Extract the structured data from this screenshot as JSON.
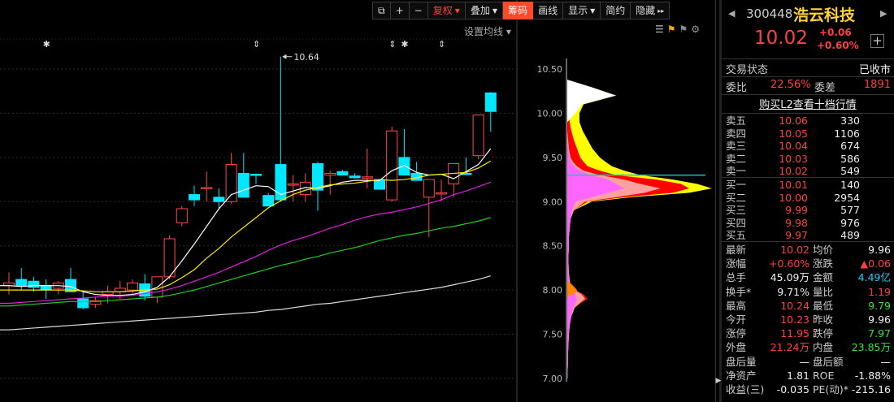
{
  "toolbar": {
    "buttons": [
      {
        "label": "⧉",
        "name": "window-mode-icon-button"
      },
      {
        "label": "+",
        "name": "zoom-in-button"
      },
      {
        "label": "−",
        "name": "zoom-out-button"
      },
      {
        "label": "复权",
        "caret": "▼",
        "name": "adjust-dropdown",
        "style": "red"
      },
      {
        "label": "叠加",
        "caret": "▼",
        "name": "overlay-dropdown"
      },
      {
        "label": "筹码",
        "name": "chips-button",
        "style": "active"
      },
      {
        "label": "画线",
        "name": "draw-line-button"
      },
      {
        "label": "显示",
        "caret": "▼",
        "name": "display-dropdown"
      },
      {
        "label": "简约",
        "name": "simple-button"
      },
      {
        "label": "隐藏",
        "caret": "▸▸",
        "name": "hide-button"
      }
    ]
  },
  "chart": {
    "setting_label": "设置均线 ▾",
    "high_marker": "10.64",
    "y_ticks": [
      "10.50",
      "10.00",
      "9.50",
      "9.00",
      "8.50",
      "8.00",
      "7.50",
      "7.00"
    ],
    "event_markers": [
      "✱",
      "⇕",
      "⇕",
      "✱",
      "⇕"
    ]
  },
  "chart_data": {
    "type": "candlestick",
    "title": "",
    "y_range": [
      6.98,
      10.64
    ],
    "ohlc": [
      [
        8.05,
        8.2,
        7.95,
        8.08
      ],
      [
        8.12,
        8.25,
        8.0,
        8.05
      ],
      [
        8.1,
        8.15,
        7.98,
        8.03
      ],
      [
        8.05,
        8.12,
        7.9,
        8.0
      ],
      [
        8.02,
        8.1,
        7.95,
        8.08
      ],
      [
        8.12,
        8.25,
        7.98,
        7.98
      ],
      [
        7.9,
        7.98,
        7.78,
        7.8
      ],
      [
        7.84,
        7.92,
        7.8,
        7.88
      ],
      [
        7.95,
        8.05,
        7.85,
        7.98
      ],
      [
        7.98,
        8.1,
        7.9,
        8.02
      ],
      [
        8.0,
        8.12,
        7.95,
        8.08
      ],
      [
        8.07,
        8.18,
        7.88,
        7.93
      ],
      [
        7.92,
        8.15,
        7.85,
        8.15
      ],
      [
        8.15,
        8.62,
        8.12,
        8.58
      ],
      [
        8.76,
        8.95,
        8.72,
        8.92
      ],
      [
        9.08,
        9.18,
        8.95,
        9.02
      ],
      [
        9.15,
        9.34,
        9.0,
        9.16
      ],
      [
        9.05,
        9.15,
        8.92,
        9.0
      ],
      [
        9.0,
        9.55,
        8.98,
        9.42
      ],
      [
        9.32,
        9.55,
        9.05,
        9.05
      ],
      [
        9.31,
        9.32,
        9.2,
        9.3
      ],
      [
        9.07,
        9.1,
        9.03,
        8.95
      ],
      [
        9.42,
        10.64,
        9.0,
        9.02
      ],
      [
        9.2,
        9.3,
        9.0,
        9.2
      ],
      [
        9.08,
        9.32,
        9.0,
        9.22
      ],
      [
        9.43,
        9.45,
        8.9,
        9.13
      ],
      [
        9.3,
        9.35,
        9.08,
        9.32
      ],
      [
        9.34,
        9.36,
        9.3,
        9.3
      ],
      [
        9.29,
        9.32,
        9.26,
        9.27
      ],
      [
        9.28,
        9.6,
        9.15,
        9.28
      ],
      [
        9.25,
        9.18,
        9.18,
        9.14
      ],
      [
        9.02,
        9.85,
        9.0,
        9.8
      ],
      [
        9.5,
        9.82,
        9.5,
        9.3
      ],
      [
        9.32,
        9.45,
        9.3,
        9.24
      ],
      [
        9.05,
        9.25,
        8.6,
        9.25
      ],
      [
        9.1,
        9.25,
        9.0,
        9.1
      ],
      [
        9.2,
        9.43,
        9.05,
        9.43
      ],
      [
        9.32,
        9.5,
        9.3,
        9.31
      ],
      [
        9.52,
        9.98,
        9.48,
        9.98
      ],
      [
        10.23,
        10.24,
        9.79,
        10.02
      ]
    ],
    "ma_series": [
      {
        "name": "MA5",
        "color": "#ffffff",
        "values": [
          8.05,
          8.04,
          8.05,
          8.05,
          8.05,
          8.04,
          7.98,
          7.95,
          7.94,
          7.94,
          7.95,
          7.98,
          8.03,
          8.15,
          8.33,
          8.52,
          8.72,
          8.92,
          9.08,
          9.13,
          9.18,
          9.17,
          9.08,
          9.12,
          9.16,
          9.15,
          9.18,
          9.22,
          9.24,
          9.24,
          9.24,
          9.35,
          9.41,
          9.33,
          9.3,
          9.31,
          9.26,
          9.34,
          9.42,
          9.6
        ]
      },
      {
        "name": "MA10",
        "color": "#ffea00",
        "values": [
          8.0,
          8.0,
          8.0,
          8.0,
          8.0,
          8.0,
          7.99,
          7.98,
          7.98,
          7.98,
          7.99,
          8.0,
          8.01,
          8.06,
          8.14,
          8.23,
          8.36,
          8.47,
          8.6,
          8.71,
          8.82,
          8.93,
          9.01,
          9.08,
          9.13,
          9.16,
          9.19,
          9.2,
          9.21,
          9.23,
          9.25,
          9.24,
          9.25,
          9.27,
          9.3,
          9.31,
          9.32,
          9.33,
          9.38,
          9.46
        ]
      },
      {
        "name": "MA20",
        "color": "#e020e0",
        "values": [
          7.85,
          7.86,
          7.87,
          7.88,
          7.89,
          7.9,
          7.91,
          7.92,
          7.93,
          7.93,
          7.94,
          7.96,
          7.98,
          8.01,
          8.05,
          8.1,
          8.15,
          8.2,
          8.26,
          8.32,
          8.38,
          8.45,
          8.51,
          8.56,
          8.6,
          8.65,
          8.7,
          8.74,
          8.79,
          8.83,
          8.86,
          8.88,
          8.91,
          8.94,
          8.98,
          9.02,
          9.08,
          9.12,
          9.17,
          9.22
        ]
      },
      {
        "name": "MA30",
        "color": "#22cc22",
        "values": [
          7.82,
          7.83,
          7.84,
          7.85,
          7.86,
          7.87,
          7.87,
          7.87,
          7.88,
          7.89,
          7.9,
          7.91,
          7.92,
          7.94,
          7.97,
          8.0,
          8.04,
          8.08,
          8.12,
          8.16,
          8.2,
          8.24,
          8.28,
          8.31,
          8.35,
          8.38,
          8.42,
          8.45,
          8.48,
          8.52,
          8.56,
          8.59,
          8.62,
          8.64,
          8.67,
          8.7,
          8.72,
          8.75,
          8.78,
          8.82
        ]
      },
      {
        "name": "MA60",
        "color": "#dddddd",
        "values": [
          7.55,
          7.56,
          7.57,
          7.58,
          7.59,
          7.6,
          7.61,
          7.62,
          7.63,
          7.64,
          7.65,
          7.66,
          7.67,
          7.68,
          7.69,
          7.7,
          7.71,
          7.72,
          7.73,
          7.74,
          7.75,
          7.77,
          7.78,
          7.8,
          7.82,
          7.84,
          7.85,
          7.87,
          7.89,
          7.91,
          7.93,
          7.95,
          7.97,
          7.99,
          8.01,
          8.03,
          8.06,
          8.09,
          8.12,
          8.16
        ]
      }
    ],
    "chip_distribution": {
      "price_levels": [
        7.0,
        7.1,
        7.2,
        7.3,
        7.4,
        7.5,
        7.6,
        7.7,
        7.8,
        7.85,
        7.9,
        7.95,
        8.0,
        8.05,
        8.1,
        8.2,
        8.3,
        8.4,
        8.5,
        8.6,
        8.7,
        8.8,
        8.9,
        9.0,
        9.05,
        9.1,
        9.15,
        9.2,
        9.25,
        9.3,
        9.35,
        9.4,
        9.45,
        9.5,
        9.6,
        9.7,
        9.8,
        9.9,
        10.0,
        10.1,
        10.2,
        10.3
      ],
      "total": [
        0.5,
        0.5,
        1,
        1,
        1.5,
        2,
        3,
        5,
        9,
        16,
        25,
        20,
        10,
        5,
        3,
        2,
        1.5,
        1.5,
        2,
        2,
        3,
        4,
        8,
        30,
        78,
        150,
        178,
        160,
        130,
        90,
        70,
        55,
        47,
        40,
        31,
        25,
        19,
        15,
        15,
        20,
        60,
        28
      ],
      "band_outer": [
        0.5,
        0.5,
        1,
        1,
        1.5,
        2,
        3,
        5,
        9,
        16,
        25,
        20,
        10,
        5,
        3,
        2,
        1.5,
        1.5,
        2,
        2,
        3,
        4,
        8,
        25,
        70,
        130,
        150,
        140,
        110,
        60,
        40,
        25,
        20,
        16,
        12,
        8,
        5,
        3,
        2,
        0,
        0,
        0
      ],
      "band_middle": [
        0.5,
        0.5,
        1,
        1,
        1.5,
        2,
        3,
        5,
        9,
        15,
        22,
        18,
        9,
        5,
        3,
        2,
        1.5,
        1.5,
        2,
        2,
        3,
        4,
        8,
        22,
        60,
        95,
        115,
        90,
        70,
        40,
        20,
        12,
        7,
        4,
        2,
        1,
        0,
        0,
        0,
        0,
        0,
        0
      ],
      "band_inner": [
        0.5,
        0.5,
        1,
        1,
        1.5,
        2,
        3,
        5,
        7,
        10,
        12,
        10,
        6,
        3,
        2,
        1.5,
        1.5,
        1.5,
        2,
        2,
        3,
        4,
        6,
        10,
        30,
        50,
        70,
        60,
        50,
        30,
        15,
        8,
        4,
        2,
        1,
        0,
        0,
        0,
        0,
        0,
        0,
        0
      ]
    }
  },
  "panel": {
    "code": "300448",
    "name": "浩云科技",
    "price": "10.02",
    "change": "+0.06",
    "change_pct": "+0.60%",
    "status_label": "交易状态",
    "status_value": "已收市",
    "weibi_label": "委比",
    "weibi_value": "22.56%",
    "weicha_label": "委差",
    "weicha_value": "1891",
    "l2_link": "购买L2查看十档行情",
    "asks": [
      {
        "label": "卖五",
        "price": "10.06",
        "vol": "330"
      },
      {
        "label": "卖四",
        "price": "10.05",
        "vol": "1106"
      },
      {
        "label": "卖三",
        "price": "10.04",
        "vol": "674"
      },
      {
        "label": "卖二",
        "price": "10.03",
        "vol": "586"
      },
      {
        "label": "卖一",
        "price": "10.02",
        "vol": "549"
      }
    ],
    "bids": [
      {
        "label": "买一",
        "price": "10.01",
        "vol": "140"
      },
      {
        "label": "买二",
        "price": "10.00",
        "vol": "2954"
      },
      {
        "label": "买三",
        "price": "9.99",
        "vol": "577"
      },
      {
        "label": "买四",
        "price": "9.98",
        "vol": "976"
      },
      {
        "label": "买五",
        "price": "9.97",
        "vol": "489"
      }
    ],
    "quotes": [
      {
        "l1": "最新",
        "v1": "10.02",
        "c1": "red",
        "l2": "均价",
        "v2": "9.96",
        "c2": "wh"
      },
      {
        "l1": "涨幅",
        "v1": "+0.60%",
        "c1": "red",
        "l2": "涨跌",
        "v2": "▲0.06",
        "c2": "red"
      },
      {
        "l1": "总手",
        "v1": "45.09万",
        "c1": "wh",
        "l2": "金额",
        "v2": "4.49亿",
        "c2": "cy"
      },
      {
        "l1": "换手*",
        "v1": "9.71%",
        "c1": "wh",
        "l2": "量比",
        "v2": "1.19",
        "c2": "red"
      },
      {
        "l1": "最高",
        "v1": "10.24",
        "c1": "red",
        "l2": "最低",
        "v2": "9.79",
        "c2": "grn"
      },
      {
        "l1": "今开",
        "v1": "10.23",
        "c1": "red",
        "l2": "昨收",
        "v2": "9.96",
        "c2": "wh"
      },
      {
        "l1": "涨停",
        "v1": "11.95",
        "c1": "red",
        "l2": "跌停",
        "v2": "7.97",
        "c2": "grn"
      },
      {
        "l1": "外盘",
        "v1": "21.24万",
        "c1": "red",
        "l2": "内盘",
        "v2": "23.85万",
        "c2": "grn"
      },
      {
        "l1": "盘后量",
        "v1": "—",
        "c1": "wh",
        "l2": "盘后额",
        "v2": "—",
        "c2": "wh"
      },
      {
        "l1": "净资产",
        "v1": "1.81",
        "c1": "wh",
        "l2": "ROE",
        "v2": "-1.88%",
        "c2": "wh"
      },
      {
        "l1": "收益(三)",
        "v1": "-0.035",
        "c1": "wh",
        "l2": "PE(动)*",
        "v2": "-215.16",
        "c2": "wh"
      }
    ]
  },
  "colors": {
    "up": "#ff4a4a",
    "down": "#00e8ff",
    "grid": "#2e2e2e",
    "axis_text": "#bbbbbb",
    "chip_total": "#ffff00",
    "chip_outer": "#ff0000",
    "chip_middle": "#ffa0a0",
    "chip_inner": "#ff66ff",
    "chip_low": "#ff8800",
    "chip_white": "#ffffff"
  }
}
